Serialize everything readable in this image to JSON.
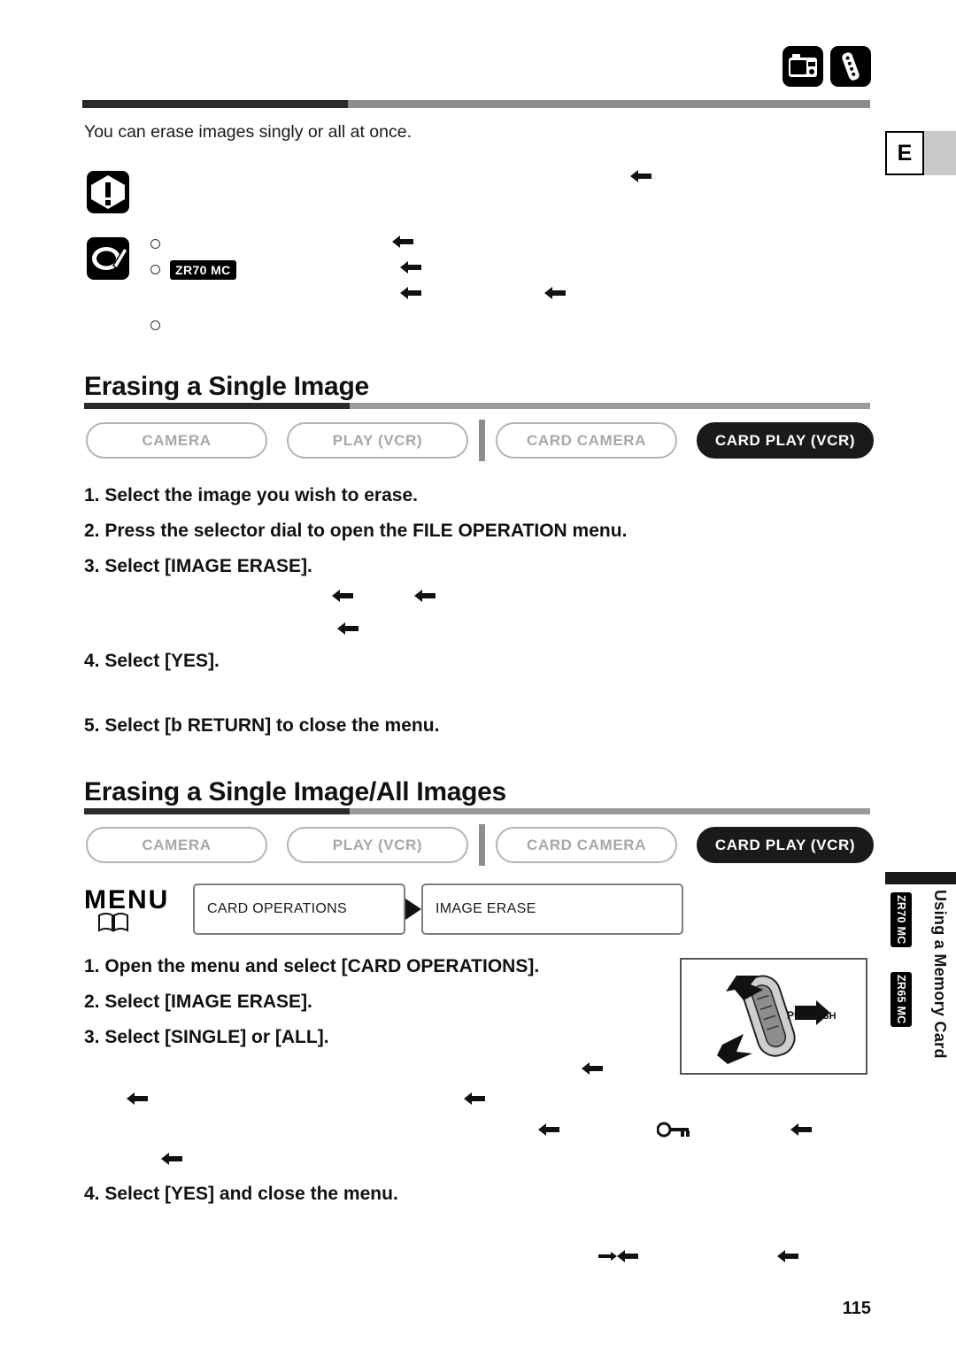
{
  "page": {
    "number": "115",
    "language_tab": "E"
  },
  "top_icons": [
    {
      "name": "card-camera-icon"
    },
    {
      "name": "remote-control-icon"
    }
  ],
  "intro": {
    "text": "You can erase images singly or all at once."
  },
  "notes": {
    "warning_icon": "warning-icon",
    "note_icon": "note-pencil-icon",
    "model_badge": "ZR70 MC"
  },
  "sections": [
    {
      "id": "single",
      "heading": "Erasing a Single Image",
      "modes": [
        {
          "label": "CAMERA",
          "active": false
        },
        {
          "label": "PLAY (VCR)",
          "active": false
        },
        {
          "label": "CARD CAMERA",
          "active": false
        },
        {
          "label": "CARD PLAY (VCR)",
          "active": true
        }
      ],
      "steps": [
        "1. Select the image you wish to erase.",
        "2. Press the selector dial to open the FILE OPERATION menu.",
        "3. Select [IMAGE ERASE].",
        "4. Select [YES].",
        "5. Select [b  RETURN] to close the menu."
      ]
    },
    {
      "id": "single-all",
      "heading": "Erasing a Single Image/All Images",
      "modes": [
        {
          "label": "CAMERA",
          "active": false
        },
        {
          "label": "PLAY (VCR)",
          "active": false
        },
        {
          "label": "CARD CAMERA",
          "active": false
        },
        {
          "label": "CARD PLAY (VCR)",
          "active": true
        }
      ],
      "menu": {
        "label": "MENU",
        "items": [
          {
            "label": "CARD OPERATIONS"
          },
          {
            "label": "IMAGE ERASE"
          }
        ]
      },
      "steps": [
        "1. Open the menu and select [CARD OPERATIONS].",
        "2. Select [IMAGE ERASE].",
        "3. Select [SINGLE] or [ALL].",
        "4. Select [YES] and close the menu."
      ]
    }
  ],
  "sidebar": {
    "title": "Using a Memory Card",
    "badges": [
      "ZR70 MC",
      "ZR65 MC"
    ]
  },
  "dial": {
    "push_label": "PUSH"
  }
}
